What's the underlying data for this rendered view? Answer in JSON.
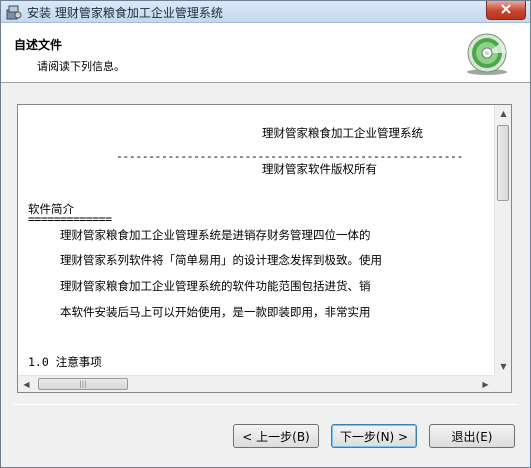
{
  "window": {
    "title": "安装 理财管家粮食加工企业管理系统"
  },
  "header": {
    "title": "自述文件",
    "subtitle": "请阅读下列信息。"
  },
  "readme": {
    "lines": [
      "理财管家粮食加工企业管理系统",
      "------------------------------------------------------",
      "理财管家软件版权所有",
      "软件简介",
      "=============",
      "理财管家粮食加工企业管理系统是进销存财务管理四位一体的",
      "理财管家系列软件将「简单易用」的设计理念发挥到极致。使用",
      "理财管家粮食加工企业管理系统的软件功能范围包括进货、销",
      "本软件安装后马上可以开始使用，是一款即装即用，非常实用",
      "1.0 注意事项"
    ]
  },
  "buttons": {
    "back": "< 上一步(B)",
    "next": "下一步(N) >",
    "exit": "退出(E)"
  },
  "icons": {
    "close": "close-icon",
    "app": "installer-icon",
    "cd": "cd-disc-icon"
  }
}
